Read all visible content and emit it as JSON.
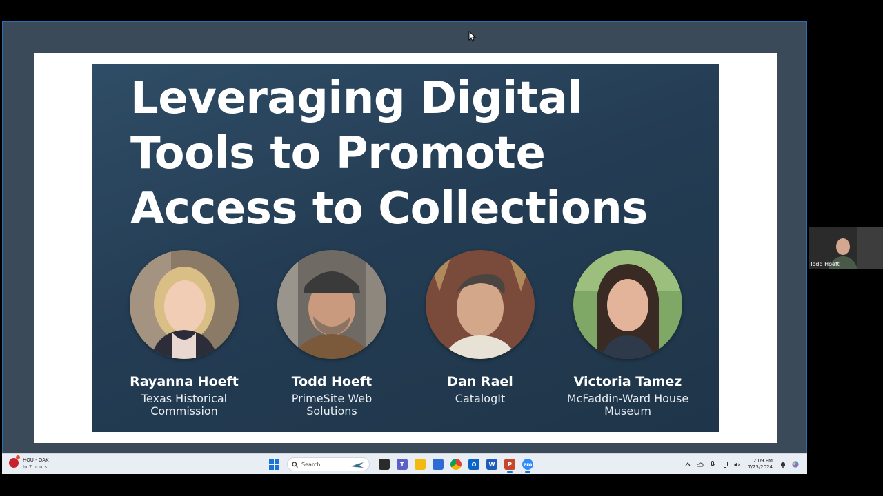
{
  "slide": {
    "title_lines": [
      "Leveraging Digital",
      "Tools to Promote",
      "Access to Collections"
    ],
    "speakers": [
      {
        "name": "Rayanna Hoeft",
        "org": "Texas Historical Commission"
      },
      {
        "name": "Todd Hoeft",
        "org": "PrimeSite Web Solutions"
      },
      {
        "name": "Dan Rael",
        "org": "CatalogIt"
      },
      {
        "name": "Victoria Tamez",
        "org": "McFaddin-Ward House Museum"
      }
    ]
  },
  "participant": {
    "name": "Todd Hoeft"
  },
  "taskbar": {
    "weather": {
      "title": "HOU - OAK",
      "subtitle": "In 7 hours",
      "icon": "flight-status-icon"
    },
    "search_placeholder": "Search",
    "apps": [
      "windows-start-icon",
      "search-icon",
      "task-view-icon",
      "teams-icon",
      "file-explorer-icon",
      "store-icon",
      "chrome-icon",
      "outlook-icon",
      "word-icon",
      "powerpoint-icon",
      "zoom-icon"
    ],
    "clock": {
      "time": "2:09 PM",
      "date": "7/23/2024"
    }
  },
  "colors": {
    "slide_bg": "#243d54",
    "screen_bg": "#3a4a59",
    "taskbar_bg": "#e9eef5",
    "accent": "#1a73d9"
  }
}
